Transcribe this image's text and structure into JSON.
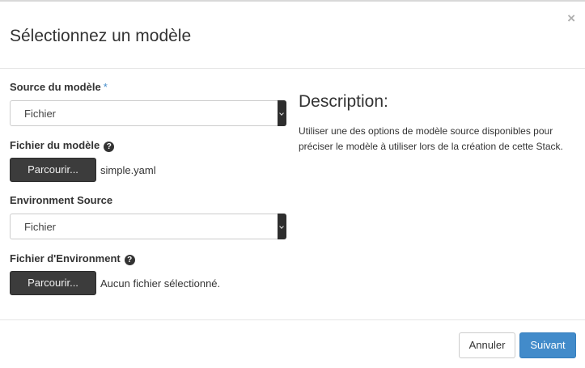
{
  "modal": {
    "title": "Sélectionnez un modèle",
    "close_label": "×"
  },
  "form": {
    "source_label": "Source du modèle",
    "required_mark": "*",
    "source_value": "Fichier",
    "template_file_label": "Fichier du modèle",
    "template_browse_label": "Parcourir...",
    "template_file_name": "simple.yaml",
    "env_source_label": "Environment Source",
    "env_source_value": "Fichier",
    "env_file_label": "Fichier d'Environment",
    "env_browse_label": "Parcourir...",
    "env_file_name": "Aucun fichier sélectionné.",
    "help_glyph": "?"
  },
  "description": {
    "title": "Description:",
    "text": "Utiliser une des options de modèle source disponibles pour préciser le modèle à utiliser lors de la création de cette Stack."
  },
  "footer": {
    "cancel_label": "Annuler",
    "next_label": "Suivant"
  },
  "colors": {
    "primary": "#428bca",
    "dark_button": "#3c3c3c"
  }
}
